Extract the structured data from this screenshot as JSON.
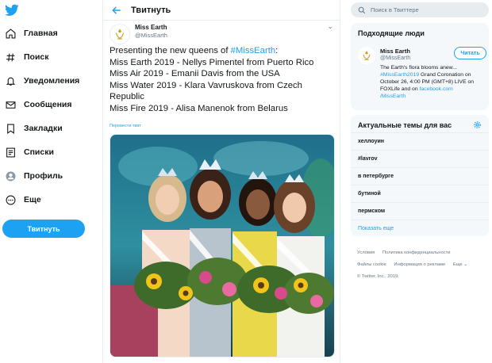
{
  "nav": {
    "items": [
      {
        "label": "Главная",
        "icon": "home-icon"
      },
      {
        "label": "Поиск",
        "icon": "hashtag-icon"
      },
      {
        "label": "Уведомления",
        "icon": "bell-icon"
      },
      {
        "label": "Сообщения",
        "icon": "envelope-icon"
      },
      {
        "label": "Закладки",
        "icon": "bookmark-icon"
      },
      {
        "label": "Списки",
        "icon": "list-icon"
      },
      {
        "label": "Профиль",
        "icon": "profile-icon"
      },
      {
        "label": "Еще",
        "icon": "more-icon"
      }
    ],
    "tweet_button": "Твитнуть"
  },
  "header": {
    "title": "Твитнуть"
  },
  "tweet": {
    "display_name": "Miss Earth",
    "handle": "@MissEarth",
    "lines": {
      "l1_pre": "Presenting the new queens of ",
      "l1_hash": "#MissEarth",
      "l1_post": ":",
      "l2": "Miss Earth 2019 - Nellys Pimentel from Puerto Rico",
      "l3": "Miss Air 2019 - Emanii Davis from the USA",
      "l4": "Miss Water 2019 - Klara Vavruskova from Czech",
      "l5": "Republic",
      "l6": "Miss Fire 2019 - Alisa Manenok from Belarus"
    },
    "translate": "Перевести твит"
  },
  "search": {
    "placeholder": "Поиск в Твиттере"
  },
  "who_to_follow": {
    "title": "Подходящие люди",
    "name": "Miss Earth",
    "handle": "@MissEarth",
    "follow_label": "Читать",
    "bio": {
      "b1": "The Earth's flora blooms anew...",
      "b2": "#MissEarth2019",
      "b2b": " Grand Coronation on",
      "b3": "October 26, 4:00 PM (GMT+8) LIVE on",
      "b4a": "FOXLife and on ",
      "b4b": "facebook.com",
      "b5": "/MissEarth"
    }
  },
  "trends": {
    "title": "Актуальные темы для вас",
    "items": [
      "хеллоуин",
      "#lavrov",
      "в петербурге",
      "бутиной",
      "пермском"
    ],
    "show_more": "Показать еще"
  },
  "footer": {
    "row1": [
      "Условия",
      "Политика конфиденциальности"
    ],
    "row2": [
      "Файлы cookie",
      "Информация о рекламе",
      "Еще ⌄"
    ],
    "copyright": "© Twitter, Inc., 2019."
  },
  "colors": {
    "accent": "#1da1f2",
    "panel": "#f5f8fa",
    "border": "#e6ecf0"
  }
}
